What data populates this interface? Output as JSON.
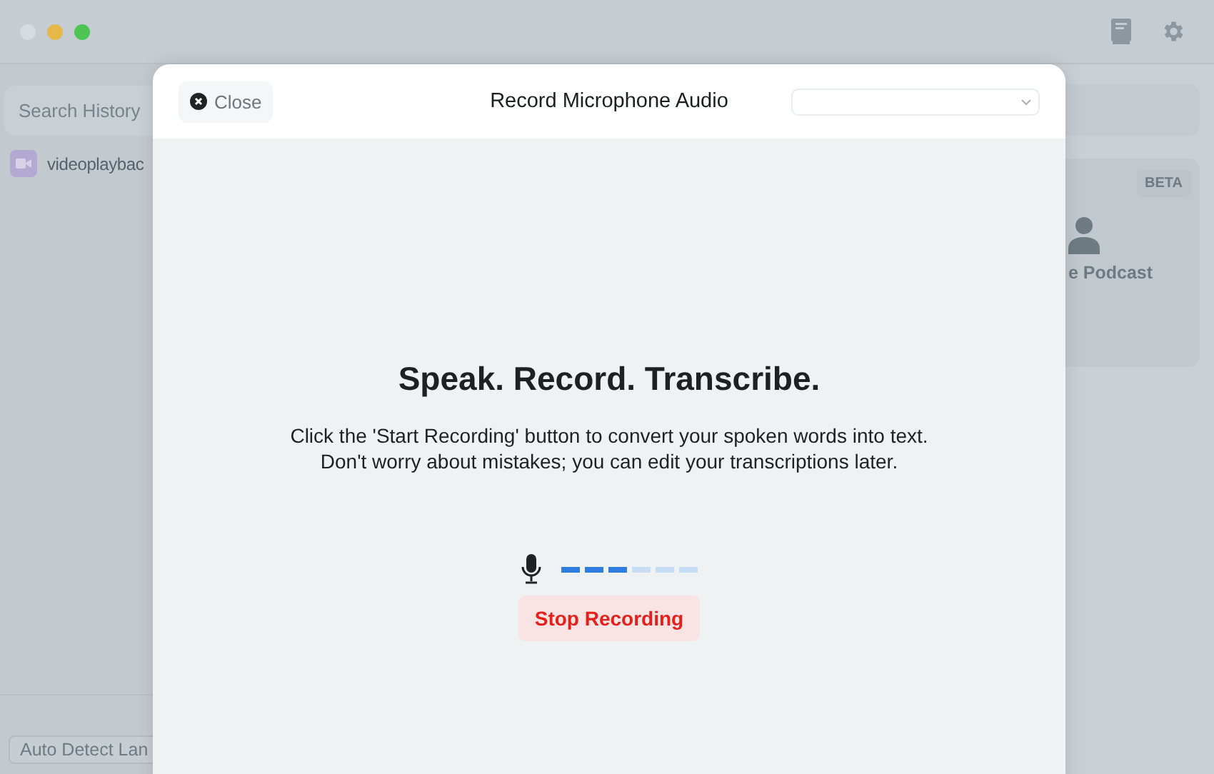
{
  "app": {
    "sidebar": {
      "search": {
        "placeholder": "Search History"
      },
      "items": [
        {
          "label": "videoplaybac",
          "selected": false
        }
      ],
      "language_button": "Auto Detect Lan"
    },
    "card": {
      "badge": "BETA",
      "label": "e Podcast"
    }
  },
  "modal": {
    "title": "Record Microphone Audio",
    "close": "Close",
    "heading": "Speak. Record. Transcribe.",
    "description": [
      "Click the 'Start Recording' button to convert your spoken words into text.",
      "Don't worry about mistakes; you can edit your transcriptions later."
    ],
    "meter": {
      "level": 0.5
    },
    "action": "Stop Recording"
  }
}
